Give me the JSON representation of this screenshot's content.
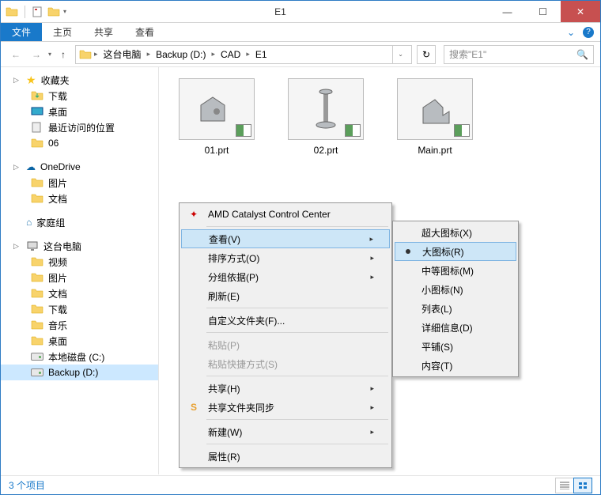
{
  "window": {
    "title": "E1"
  },
  "ribbon": {
    "tabs": {
      "file": "文件",
      "home": "主页",
      "share": "共享",
      "view": "查看"
    }
  },
  "breadcrumb": {
    "items": [
      "这台电脑",
      "Backup (D:)",
      "CAD",
      "E1"
    ]
  },
  "search": {
    "placeholder": "搜索\"E1\""
  },
  "sidebar": {
    "favorites": {
      "label": "收藏夹",
      "items": [
        "下载",
        "桌面",
        "最近访问的位置",
        "06"
      ]
    },
    "onedrive": {
      "label": "OneDrive",
      "items": [
        "图片",
        "文档"
      ]
    },
    "homegroup": {
      "label": "家庭组"
    },
    "thispc": {
      "label": "这台电脑",
      "items": [
        "视频",
        "图片",
        "文档",
        "下载",
        "音乐",
        "桌面",
        "本地磁盘 (C:)",
        "Backup (D:)"
      ]
    }
  },
  "files": {
    "items": [
      {
        "name": "01.prt"
      },
      {
        "name": "02.prt"
      },
      {
        "name": "Main.prt"
      }
    ]
  },
  "context_menu": {
    "amd": "AMD Catalyst Control Center",
    "view": "查看(V)",
    "sort": "排序方式(O)",
    "group": "分组依据(P)",
    "refresh": "刷新(E)",
    "customize": "自定义文件夹(F)...",
    "paste": "粘贴(P)",
    "paste_shortcut": "粘贴快捷方式(S)",
    "share": "共享(H)",
    "sync": "共享文件夹同步",
    "new": "新建(W)",
    "properties": "属性(R)"
  },
  "view_submenu": {
    "xlarge": "超大图标(X)",
    "large": "大图标(R)",
    "medium": "中等图标(M)",
    "small": "小图标(N)",
    "list": "列表(L)",
    "details": "详细信息(D)",
    "tiles": "平铺(S)",
    "content": "内容(T)"
  },
  "statusbar": {
    "text": "3 个项目"
  }
}
